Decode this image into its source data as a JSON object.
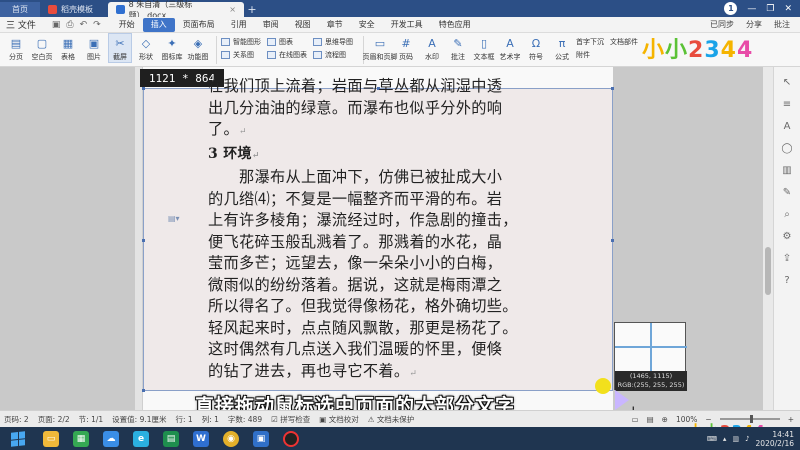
{
  "tabs": {
    "home": "首页",
    "docer": "稻壳模板",
    "doc": "8 朱自清（三级标题）.docx",
    "win_count": "1"
  },
  "menu": {
    "file": "三 文件",
    "items": [
      "开始",
      "插入",
      "页面布局",
      "引用",
      "审阅",
      "视图",
      "章节",
      "安全",
      "开发工具",
      "特色应用"
    ],
    "active_index": 1,
    "right": [
      "已同步",
      "分享",
      "批注"
    ]
  },
  "ribbon": {
    "buttons": [
      {
        "label": "分页",
        "icon": "▤"
      },
      {
        "label": "空白页",
        "icon": "▢"
      },
      {
        "label": "表格",
        "icon": "▦"
      },
      {
        "label": "图片",
        "icon": "▣"
      },
      {
        "label": "截屏",
        "icon": "✂"
      },
      {
        "label": "形状",
        "icon": "◇"
      },
      {
        "label": "图标库",
        "icon": "✦"
      },
      {
        "label": "功能图",
        "icon": "◈"
      }
    ],
    "col1": [
      "智能图形",
      "关系图"
    ],
    "col2": [
      "图表",
      "在线图表"
    ],
    "col3": [
      "思维导图",
      "流程图"
    ],
    "buttons2": [
      {
        "label": "页眉和页脚",
        "icon": "▭"
      },
      {
        "label": "页码",
        "icon": "#"
      },
      {
        "label": "水印",
        "icon": "A"
      },
      {
        "label": "批注",
        "icon": "✎"
      },
      {
        "label": "文本框",
        "icon": "▯"
      },
      {
        "label": "艺术字",
        "icon": "A"
      },
      {
        "label": "符号",
        "icon": "Ω"
      },
      {
        "label": "公式",
        "icon": "π"
      }
    ],
    "col4": [
      "首字下沉",
      "附件",
      "文档部件"
    ]
  },
  "logo": [
    "小",
    "小",
    "2",
    "3",
    "4",
    "4"
  ],
  "selection_size": "1121 * 864",
  "document": {
    "lines": [
      {
        "text": "在我们顶上流着；岩面与草丛都从润湿中透",
        "indent": false
      },
      {
        "text": "出几分油油的绿意。而瀑布也似乎分外的响",
        "indent": false
      },
      {
        "text": "了。",
        "indent": false,
        "mark": "↵"
      },
      {
        "text": "3 环境",
        "indent": false,
        "heading": true,
        "mark": "↵"
      },
      {
        "text": "那瀑布从上面冲下，仿佛已被扯成大小",
        "indent": true
      },
      {
        "text": "的几绺⑷；不复是一幅整齐而平滑的布。岩",
        "indent": false
      },
      {
        "text": "上有许多棱角；瀑流经过时，作急剧的撞击，",
        "indent": false
      },
      {
        "text": "便飞花碎玉般乱溅着了。那溅着的水花，晶",
        "indent": false
      },
      {
        "text": "莹而多芒；远望去，像一朵朵小小的白梅，",
        "indent": false
      },
      {
        "text": "微雨似的纷纷落着。据说，这就是梅雨潭之",
        "indent": false
      },
      {
        "text": "所以得名了。但我觉得像杨花，格外确切些。",
        "indent": false
      },
      {
        "text": "轻风起来时，点点随风飘散，那更是杨花了。",
        "indent": false
      },
      {
        "text": "这时偶然有几点送入我们温暖的怀里，便倏",
        "indent": false
      },
      {
        "text": "的钻了进去，再也寻它不着。",
        "indent": false,
        "mark": "↵"
      }
    ]
  },
  "magnifier": {
    "coords": "(1465, 1115)",
    "rgb": "RGB:(255, 255, 255)"
  },
  "subtitle": "直接拖动鼠标选中页面的大部分文字",
  "status": {
    "page": "页码: 2",
    "pages": "页面: 2/2",
    "section": "节: 1/1",
    "setting": "设置值: 9.1厘米",
    "row": "行: 1",
    "col": "列: 1",
    "words": "字数: 489",
    "spell": "拼写检查",
    "review": "文档校对",
    "protect": "文档未保护",
    "zoom": "100%"
  },
  "clock": {
    "time": "14:41",
    "date": "2020/2/16"
  }
}
